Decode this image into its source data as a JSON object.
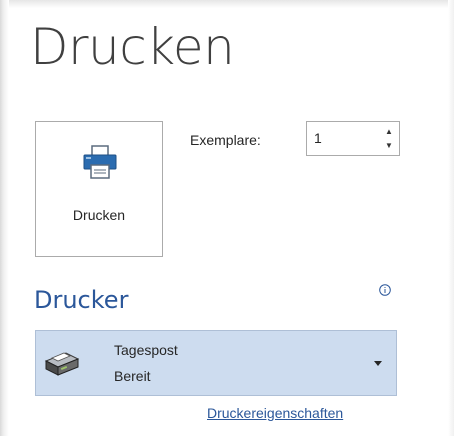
{
  "page": {
    "title": "Drucken"
  },
  "print_button": {
    "label": "Drucken",
    "icon": "printer-icon"
  },
  "copies": {
    "label": "Exemplare:",
    "value": "1",
    "spin_up_icon": "triangle-up",
    "spin_down_icon": "triangle-down"
  },
  "printer_section": {
    "title": "Drucker",
    "info_icon": "info-icon",
    "selected_printer": {
      "name": "Tagespost",
      "status": "Bereit",
      "icon": "printer-device-icon"
    },
    "properties_link": "Druckereigenschaften"
  },
  "colors": {
    "accent": "#2b579a",
    "selection_bg": "#cddcef",
    "title_text": "#404040",
    "border": "#ababab"
  }
}
